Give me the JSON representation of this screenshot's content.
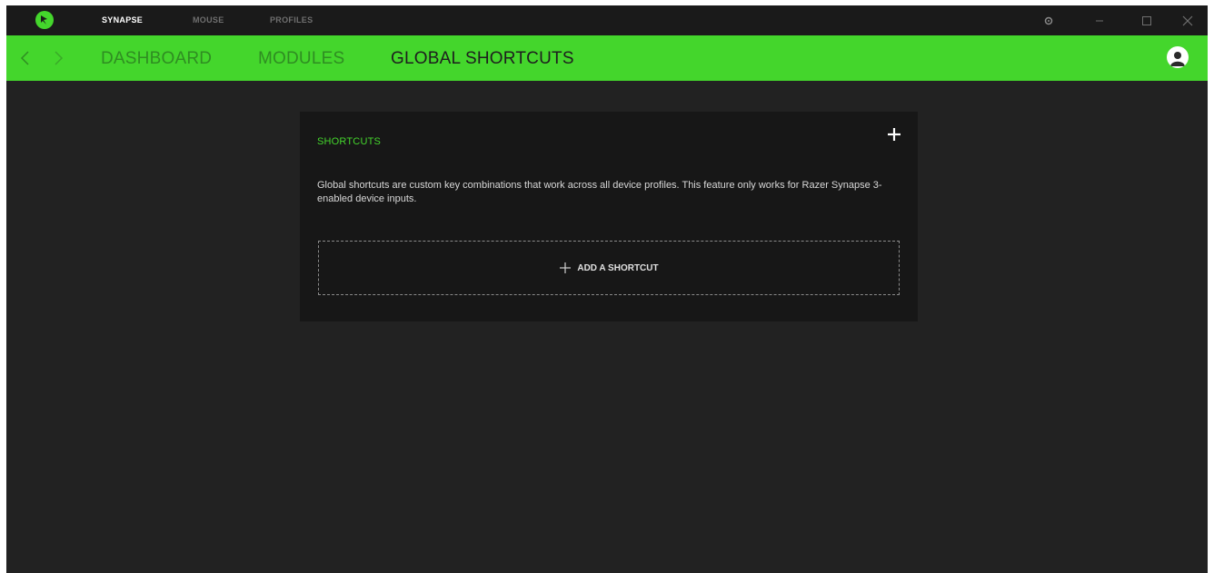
{
  "titlebar": {
    "logo_icon": "razer-logo-icon",
    "tabs": [
      {
        "label": "SYNAPSE",
        "active": true
      },
      {
        "label": "MOUSE",
        "active": false
      },
      {
        "label": "PROFILES",
        "active": false
      }
    ],
    "controls": [
      "settings-icon",
      "minimize-icon",
      "maximize-icon",
      "close-icon"
    ]
  },
  "navbar": {
    "back_icon": "chevron-left-icon",
    "forward_icon": "chevron-right-icon",
    "tabs": [
      {
        "label": "DASHBOARD",
        "active": false
      },
      {
        "label": "MODULES",
        "active": false
      },
      {
        "label": "GLOBAL SHORTCUTS",
        "active": true
      }
    ],
    "avatar_icon": "user-avatar-icon"
  },
  "shortcuts_card": {
    "title": "SHORTCUTS",
    "add_icon": "plus-icon",
    "description": "Global shortcuts are custom key combinations that work across all device profiles. This feature only works for Razer Synapse 3-enabled device inputs.",
    "add_shortcut_label": "ADD A SHORTCUT"
  },
  "colors": {
    "accent": "#44d62c",
    "background": "#222222",
    "card": "#171717",
    "titlebar": "#1a1a1a"
  }
}
